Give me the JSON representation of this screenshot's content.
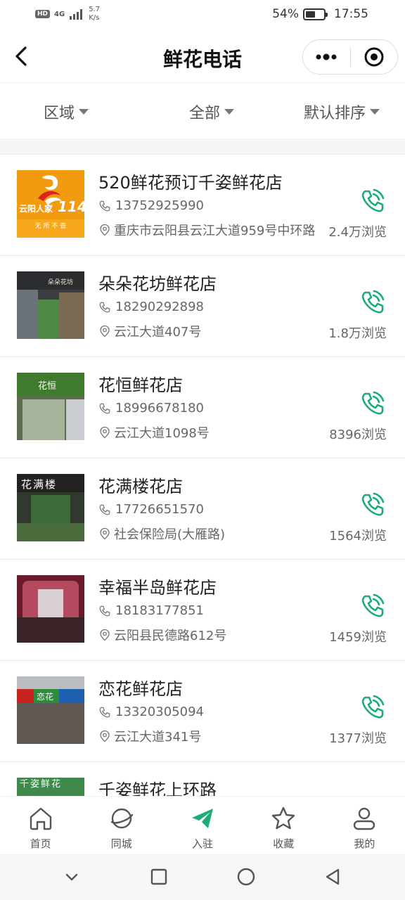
{
  "status_bar": {
    "hd": "HD",
    "signal": "4G",
    "net_speed_value": "5.7",
    "net_speed_unit": "K/s",
    "battery_percent": "54%",
    "battery_level": 0.54,
    "time": "17:55"
  },
  "nav": {
    "title": "鲜花电话",
    "back_icon": "chevron-left-icon",
    "more_icon": "more-dots-icon",
    "close_icon": "target-close-icon"
  },
  "filters": [
    {
      "label": "区域"
    },
    {
      "label": "全部"
    },
    {
      "label": "默认排序"
    }
  ],
  "shops": [
    {
      "name": "520鲜花预订千姿鲜花店",
      "phone": "13752925990",
      "address": "重庆市云阳县云江大道959号中环路",
      "views": "2.4万浏览",
      "thumb": "logo",
      "logo_title": "云阳人家",
      "logo_num": "114",
      "logo_sub": "无 所 不 查"
    },
    {
      "name": "朵朵花坊鲜花店",
      "phone": "18290292898",
      "address": "云江大道407号",
      "views": "1.8万浏览",
      "thumb": "photo",
      "sign_text": "朵朵花坊"
    },
    {
      "name": "花恒鲜花店",
      "phone": "18996678180",
      "address": "云江大道1098号",
      "views": "8396浏览",
      "thumb": "photo",
      "sign_text": "花恒"
    },
    {
      "name": "花满楼花店",
      "phone": "17726651570",
      "address": "社会保险局(大雁路)",
      "views": "1564浏览",
      "thumb": "photo",
      "sign_text": "花满楼"
    },
    {
      "name": "幸福半岛鲜花店",
      "phone": "18183177851",
      "address": "云阳县民德路612号",
      "views": "1459浏览",
      "thumb": "photo",
      "sign_text": ""
    },
    {
      "name": "恋花鲜花店",
      "phone": "13320305094",
      "address": "云江大道341号",
      "views": "1377浏览",
      "thumb": "photo",
      "sign_text": "恋花"
    },
    {
      "name": "千姿鲜花上环路",
      "phone": "",
      "address": "",
      "views": "",
      "thumb": "photo",
      "sign_text": "千姿鲜花"
    }
  ],
  "tabs": [
    {
      "label": "首页",
      "icon": "home-icon"
    },
    {
      "label": "同城",
      "icon": "planet-icon"
    },
    {
      "label": "入驻",
      "icon": "paper-plane-icon"
    },
    {
      "label": "收藏",
      "icon": "star-icon"
    },
    {
      "label": "我的",
      "icon": "user-icon"
    }
  ],
  "colors": {
    "accent_green": "#1aad75",
    "logo_orange": "#f29b0f",
    "text_primary": "#222222",
    "text_secondary": "#666666"
  }
}
